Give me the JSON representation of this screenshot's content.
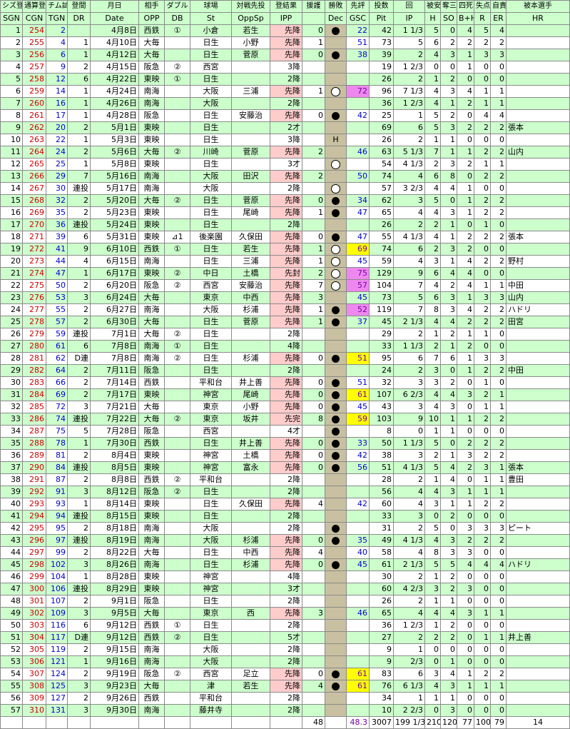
{
  "headers_jp": [
    "シズ登",
    "通算登",
    "チム試",
    "登間",
    "月日",
    "相手",
    "ダブル",
    "球場",
    "対戦先投",
    "登結果",
    "援護",
    "勝敗",
    "先評",
    "投数",
    "回",
    "被安",
    "奪三",
    "四死",
    "失点",
    "自責",
    "被本選手"
  ],
  "headers_en": [
    "SGN",
    "CGN",
    "TGN",
    "DR",
    "Date",
    "OPP",
    "DB",
    "St",
    "OppSp",
    "IPP",
    "",
    "Dec",
    "GSC",
    "Pit",
    "IP",
    "H",
    "SO",
    "B+H",
    "R",
    "ER",
    "HR"
  ],
  "rows": [
    [
      "1",
      "254",
      "2",
      "",
      "4月8日",
      "西鉄",
      "①",
      "小倉",
      "若生",
      "先降",
      "0",
      "L",
      "22",
      "42",
      "1 1/3",
      "5",
      "0",
      "4",
      "5",
      "4",
      ""
    ],
    [
      "2",
      "255",
      "4",
      "1",
      "4月10日",
      "大毎",
      "",
      "日生",
      "小野",
      "先降",
      "1",
      "",
      "51",
      "73",
      "5",
      "6",
      "2",
      "2",
      "2",
      "2",
      ""
    ],
    [
      "3",
      "256",
      "6",
      "1",
      "4月12日",
      "大毎",
      "",
      "日生",
      "菅原",
      "先降",
      "0",
      "L",
      "38",
      "39",
      "2",
      "4",
      "3",
      "1",
      "3",
      "3",
      ""
    ],
    [
      "4",
      "257",
      "9",
      "2",
      "4月15日",
      "阪急",
      "②",
      "西宮",
      "",
      "3降",
      "",
      "",
      "",
      "19",
      "1 2/3",
      "0",
      "0",
      "1",
      "0",
      "0",
      ""
    ],
    [
      "5",
      "258",
      "12",
      "6",
      "4月22日",
      "東映",
      "①",
      "日生",
      "",
      "2降",
      "",
      "",
      "",
      "26",
      "2",
      "1",
      "2",
      "0",
      "0",
      "0",
      ""
    ],
    [
      "6",
      "259",
      "14",
      "1",
      "4月24日",
      "南海",
      "",
      "大阪",
      "三浦",
      "先降",
      "1",
      "W",
      "72",
      "96",
      "7 1/3",
      "4",
      "3",
      "4",
      "1",
      "1",
      ""
    ],
    [
      "7",
      "260",
      "16",
      "1",
      "4月26日",
      "南海",
      "",
      "大阪",
      "",
      "2降",
      "",
      "",
      "",
      "36",
      "1 2/3",
      "4",
      "1",
      "2",
      "1",
      "1",
      ""
    ],
    [
      "8",
      "261",
      "17",
      "1",
      "4月28日",
      "阪急",
      "",
      "日生",
      "安藤治",
      "先降",
      "0",
      "L",
      "42",
      "25",
      "1",
      "5",
      "2",
      "0",
      "4",
      "4",
      ""
    ],
    [
      "9",
      "262",
      "20",
      "2",
      "5月1日",
      "東映",
      "",
      "日生",
      "",
      "2才",
      "",
      "",
      "",
      "69",
      "6",
      "5",
      "3",
      "2",
      "2",
      "2",
      "張本"
    ],
    [
      "10",
      "263",
      "22",
      "1",
      "5月3日",
      "東映",
      "",
      "日生",
      "",
      "3降",
      "",
      "H",
      "",
      "26",
      "2",
      "1",
      "1",
      "0",
      "0",
      "0",
      ""
    ],
    [
      "11",
      "264",
      "24",
      "2",
      "5月6日",
      "大毎",
      "②",
      "川崎",
      "菅原",
      "先降",
      "2",
      "",
      "46",
      "63",
      "5 1/3",
      "7",
      "1",
      "1",
      "2",
      "2",
      "山内"
    ],
    [
      "12",
      "265",
      "25",
      "1",
      "5月8日",
      "東映",
      "",
      "日生",
      "",
      "3才",
      "",
      "W",
      "",
      "54",
      "4 1/3",
      "2",
      "3",
      "2",
      "1",
      "1",
      ""
    ],
    [
      "13",
      "266",
      "29",
      "7",
      "5月16日",
      "南海",
      "",
      "大阪",
      "田沢",
      "先降",
      "2",
      "",
      "50",
      "74",
      "4",
      "6",
      "8",
      "0",
      "2",
      "2",
      ""
    ],
    [
      "14",
      "267",
      "30",
      "連投",
      "5月17日",
      "南海",
      "",
      "大阪",
      "",
      "2降",
      "",
      "W",
      "",
      "57",
      "3 2/3",
      "4",
      "4",
      "1",
      "0",
      "0",
      ""
    ],
    [
      "15",
      "268",
      "32",
      "2",
      "5月20日",
      "大毎",
      "②",
      "日生",
      "菅原",
      "先降",
      "0",
      "L",
      "34",
      "62",
      "3",
      "5",
      "0",
      "1",
      "2",
      "2",
      ""
    ],
    [
      "16",
      "269",
      "35",
      "2",
      "5月23日",
      "東映",
      "",
      "日生",
      "尾崎",
      "先降",
      "1",
      "L",
      "47",
      "65",
      "4",
      "4",
      "3",
      "1",
      "2",
      "2",
      ""
    ],
    [
      "17",
      "270",
      "36",
      "連投",
      "5月24日",
      "東映",
      "",
      "日生",
      "",
      "2降",
      "",
      "",
      "",
      "26",
      "2",
      "2",
      "1",
      "0",
      "1",
      "0",
      ""
    ],
    [
      "18",
      "271",
      "39",
      "6",
      "5月31日",
      "東映",
      "⊿1",
      "後楽園",
      "久保田",
      "先降",
      "0",
      "L",
      "47",
      "55",
      "4 1/3",
      "4",
      "1",
      "2",
      "2",
      "2",
      "張本"
    ],
    [
      "19",
      "272",
      "41",
      "9",
      "6月10日",
      "西鉄",
      "①",
      "日生",
      "若生",
      "先降",
      "1",
      "W",
      "69",
      "74",
      "6",
      "2",
      "3",
      "2",
      "0",
      "0",
      ""
    ],
    [
      "20",
      "273",
      "44",
      "4",
      "6月15日",
      "南海",
      "",
      "日生",
      "三浦",
      "先降",
      "1",
      "W",
      "45",
      "59",
      "4",
      "3",
      "1",
      "4",
      "2",
      "2",
      "野村"
    ],
    [
      "21",
      "274",
      "47",
      "1",
      "6月17日",
      "東映",
      "②",
      "中日",
      "土橋",
      "先封",
      "2",
      "W",
      "75",
      "129",
      "9",
      "6",
      "4",
      "4",
      "0",
      "0",
      ""
    ],
    [
      "22",
      "275",
      "50",
      "2",
      "6月20日",
      "阪急",
      "②",
      "西宮",
      "安藤治",
      "先降",
      "7",
      "W",
      "57",
      "104",
      "7",
      "4",
      "2",
      "4",
      "1",
      "1",
      "中田"
    ],
    [
      "23",
      "276",
      "53",
      "3",
      "6月24日",
      "大毎",
      "",
      "東京",
      "中西",
      "先降",
      "3",
      "",
      "45",
      "73",
      "5",
      "6",
      "3",
      "1",
      "3",
      "3",
      "山内"
    ],
    [
      "24",
      "277",
      "55",
      "2",
      "6月27日",
      "南海",
      "",
      "大阪",
      "杉浦",
      "先降",
      "1",
      "L",
      "52",
      "119",
      "7",
      "8",
      "3",
      "4",
      "2",
      "2",
      "ハドリ"
    ],
    [
      "25",
      "278",
      "57",
      "2",
      "6月30日",
      "大毎",
      "",
      "日生",
      "菅原",
      "先降",
      "1",
      "L",
      "37",
      "45",
      "2 1/3",
      "4",
      "4",
      "2",
      "2",
      "2",
      "田宮"
    ],
    [
      "26",
      "279",
      "59",
      "連投",
      "7月1日",
      "大毎",
      "②",
      "日生",
      "",
      "2降",
      "",
      "",
      "",
      "29",
      "2",
      "1",
      "2",
      "1",
      "1",
      "0",
      ""
    ],
    [
      "27",
      "280",
      "61",
      "6",
      "7月8日",
      "南海",
      "①",
      "日生",
      "",
      "4降",
      "",
      "",
      "",
      "33",
      "1 1/3",
      "2",
      "1",
      "2",
      "0",
      "0",
      ""
    ],
    [
      "28",
      "281",
      "62",
      "D連",
      "7月8日",
      "南海",
      "②",
      "日生",
      "杉浦",
      "先降",
      "0",
      "L",
      "51",
      "95",
      "6",
      "7",
      "6",
      "1",
      "3",
      "3",
      ""
    ],
    [
      "29",
      "282",
      "64",
      "2",
      "7月11日",
      "阪急",
      "",
      "日生",
      "",
      "2降",
      "",
      "",
      "",
      "24",
      "2",
      "3",
      "0",
      "1",
      "2",
      "2",
      "中田"
    ],
    [
      "30",
      "283",
      "66",
      "2",
      "7月14日",
      "西鉄",
      "",
      "平和台",
      "井上善",
      "先降",
      "0",
      "L",
      "51",
      "32",
      "3",
      "3",
      "2",
      "0",
      "1",
      "0",
      ""
    ],
    [
      "31",
      "284",
      "69",
      "2",
      "7月17日",
      "東映",
      "",
      "神宮",
      "尾崎",
      "先降",
      "0",
      "L",
      "61",
      "107",
      "6 2/3",
      "4",
      "4",
      "3",
      "2",
      "1",
      ""
    ],
    [
      "32",
      "285",
      "72",
      "3",
      "7月21日",
      "大毎",
      "",
      "東京",
      "小野",
      "先降",
      "0",
      "L",
      "45",
      "43",
      "3",
      "4",
      "3",
      "0",
      "1",
      "1",
      ""
    ],
    [
      "33",
      "286",
      "74",
      "連投",
      "7月22日",
      "大毎",
      "②",
      "東京",
      "坂井",
      "先完",
      "8",
      "L",
      "59",
      "103",
      "9",
      "10",
      "1",
      "1",
      "2",
      "2",
      ""
    ],
    [
      "34",
      "287",
      "75",
      "5",
      "7月28日",
      "阪急",
      "",
      "西宮",
      "",
      "4才",
      "",
      "L",
      "",
      "8",
      "0",
      "1",
      "1",
      "0",
      "0",
      "0",
      ""
    ],
    [
      "35",
      "288",
      "78",
      "1",
      "7月30日",
      "西鉄",
      "",
      "日生",
      "井上善",
      "先降",
      "0",
      "L",
      "33",
      "50",
      "1 1/3",
      "5",
      "0",
      "2",
      "2",
      "2",
      ""
    ],
    [
      "36",
      "289",
      "81",
      "2",
      "8月4日",
      "東映",
      "",
      "神宮",
      "土橋",
      "先降",
      "0",
      "L",
      "42",
      "38",
      "3",
      "2",
      "1",
      "3",
      "2",
      "2",
      ""
    ],
    [
      "37",
      "290",
      "84",
      "連投",
      "8月5日",
      "東映",
      "",
      "神宮",
      "富永",
      "先降",
      "0",
      "L",
      "56",
      "51",
      "4 1/3",
      "5",
      "4",
      "2",
      "3",
      "1",
      "張本"
    ],
    [
      "38",
      "291",
      "87",
      "2",
      "8月8日",
      "西鉄",
      "②",
      "平和台",
      "",
      "2降",
      "",
      "",
      "",
      "28",
      "2",
      "1",
      "4",
      "0",
      "1",
      "1",
      "豊田"
    ],
    [
      "39",
      "292",
      "91",
      "3",
      "8月12日",
      "阪急",
      "②",
      "日生",
      "",
      "2降",
      "",
      "",
      "",
      "56",
      "4",
      "4",
      "3",
      "1",
      "1",
      "1",
      ""
    ],
    [
      "40",
      "293",
      "93",
      "1",
      "8月14日",
      "東映",
      "",
      "日生",
      "久保田",
      "先降",
      "4",
      "",
      "42",
      "60",
      "4",
      "3",
      "1",
      "1",
      "2",
      "2",
      ""
    ],
    [
      "41",
      "294",
      "94",
      "連投",
      "8月15日",
      "東映",
      "",
      "日生",
      "",
      "2降",
      "",
      "",
      "",
      "33",
      "3",
      "0",
      "2",
      "0",
      "0",
      "0",
      ""
    ],
    [
      "42",
      "295",
      "95",
      "2",
      "8月18日",
      "南海",
      "",
      "大阪",
      "",
      "2降",
      "",
      "L",
      "",
      "31",
      "2",
      "5",
      "0",
      "3",
      "3",
      "3",
      "ピート"
    ],
    [
      "43",
      "296",
      "97",
      "連投",
      "8月19日",
      "南海",
      "",
      "大阪",
      "杉浦",
      "先降",
      "0",
      "L",
      "35",
      "49",
      "4 1/3",
      "4",
      "3",
      "2",
      "2",
      "2",
      ""
    ],
    [
      "44",
      "297",
      "99",
      "2",
      "8月22日",
      "大毎",
      "",
      "日生",
      "中西",
      "先降",
      "4",
      "",
      "40",
      "58",
      "4",
      "8",
      "3",
      "3",
      "0",
      "0",
      ""
    ],
    [
      "45",
      "298",
      "102",
      "3",
      "8月26日",
      "南海",
      "",
      "日生",
      "杉浦",
      "先降",
      "0",
      "L",
      "45",
      "61",
      "2 1/3",
      "5",
      "5",
      "4",
      "4",
      "4",
      "ハドリ"
    ],
    [
      "46",
      "299",
      "104",
      "1",
      "8月28日",
      "東映",
      "",
      "神宮",
      "",
      "4降",
      "",
      "",
      "",
      "30",
      "2",
      "1",
      "2",
      "0",
      "0",
      "0",
      ""
    ],
    [
      "47",
      "300",
      "106",
      "連投",
      "8月29日",
      "東映",
      "",
      "神宮",
      "",
      "3才",
      "",
      "",
      "",
      "60",
      "4 2/3",
      "3",
      "2",
      "3",
      "0",
      "0",
      ""
    ],
    [
      "48",
      "301",
      "107",
      "2",
      "9月1日",
      "阪急",
      "",
      "日生",
      "",
      "2降",
      "",
      "",
      "",
      "26",
      "2",
      "1",
      "1",
      "0",
      "0",
      "0",
      ""
    ],
    [
      "49",
      "302",
      "109",
      "3",
      "9月5日",
      "大毎",
      "",
      "東京",
      "西",
      "先降",
      "3",
      "",
      "46",
      "65",
      "4",
      "4",
      "4",
      "3",
      "1",
      "1",
      ""
    ],
    [
      "50",
      "303",
      "116",
      "6",
      "9月12日",
      "西鉄",
      "①",
      "日生",
      "",
      "2降",
      "",
      "",
      "",
      "36",
      "1 2/3",
      "1",
      "2",
      "0",
      "0",
      "0",
      ""
    ],
    [
      "51",
      "304",
      "117",
      "D連",
      "9月12日",
      "西鉄",
      "②",
      "日生",
      "",
      "5才",
      "",
      "",
      "",
      "27",
      "2",
      "2",
      "2",
      "0",
      "1",
      "1",
      "井上善"
    ],
    [
      "52",
      "305",
      "119",
      "2",
      "9月15日",
      "南海",
      "",
      "大阪",
      "",
      "2降",
      "",
      "",
      "",
      "9",
      "1",
      "0",
      "0",
      "0",
      "0",
      "0",
      ""
    ],
    [
      "53",
      "306",
      "121",
      "1",
      "9月16日",
      "南海",
      "",
      "大阪",
      "",
      "2降",
      "",
      "",
      "",
      "9",
      "2/3",
      "0",
      "1",
      "0",
      "0",
      "0",
      ""
    ],
    [
      "54",
      "307",
      "124",
      "2",
      "9月19日",
      "阪急",
      "②",
      "西宮",
      "足立",
      "先降",
      "0",
      "L",
      "61",
      "83",
      "6",
      "3",
      "4",
      "1",
      "2",
      "2",
      ""
    ],
    [
      "55",
      "308",
      "125",
      "3",
      "9月23日",
      "大毎",
      "",
      "津",
      "若生",
      "先降",
      "4",
      "L",
      "61",
      "76",
      "6 1/3",
      "4",
      "3",
      "1",
      "1",
      "1",
      ""
    ],
    [
      "56",
      "309",
      "127",
      "2",
      "9月26日",
      "西鉄",
      "",
      "平和台",
      "",
      "2降",
      "",
      "",
      "",
      "34",
      "1",
      "1",
      "1",
      "0",
      "0",
      "0",
      ""
    ],
    [
      "57",
      "310",
      "131",
      "3",
      "9月30日",
      "南海",
      "",
      "藤井寺",
      "",
      "2降",
      "",
      "",
      "",
      "10",
      "2 2/3",
      "0",
      "3",
      "0",
      "0",
      "0",
      ""
    ]
  ],
  "ipp_pink_rows": [
    1,
    2,
    3,
    6,
    8,
    11,
    13,
    15,
    16,
    18,
    19,
    20,
    21,
    22,
    23,
    24,
    25,
    28,
    30,
    31,
    32,
    33,
    35,
    36,
    37,
    40,
    43,
    44,
    45,
    49,
    54,
    55
  ],
  "gsc_purple_rows": [
    6,
    21,
    22,
    24
  ],
  "gsc_yellow_rows": [
    19,
    28,
    31,
    33,
    54,
    55
  ],
  "totals": [
    "",
    "",
    "",
    "",
    "",
    "",
    "",
    "",
    "",
    "",
    "48",
    "",
    "48.3",
    "3007",
    "199 1/3",
    "210",
    "120",
    "77",
    "100",
    "79",
    "14"
  ],
  "colors": {
    "header_bg": "#ccffcc",
    "row_alt_bg": "#ccffcc",
    "dec_bg": "#c8c0a0",
    "ipp_pink": "#ffcccc",
    "gsc_purple": "#ee88ee",
    "gsc_yellow": "#ffff00",
    "cgn_red": "#cc0000",
    "tgn_blue": "#0000cc"
  }
}
